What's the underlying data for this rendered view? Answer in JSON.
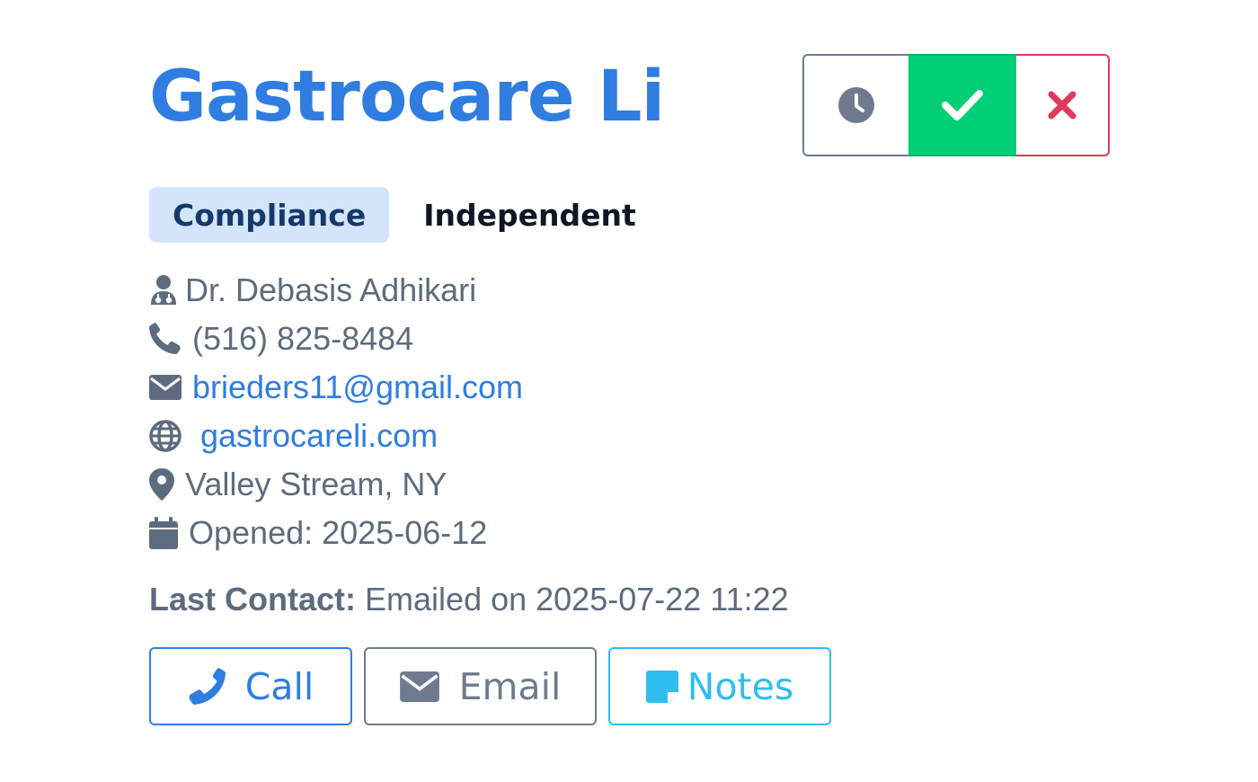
{
  "header": {
    "title": "Gastrocare Li"
  },
  "status_buttons": [
    {
      "name": "pending",
      "icon": "clock-icon",
      "color": "#6e7b8f"
    },
    {
      "name": "approve",
      "icon": "check-icon",
      "color": "#00cf75",
      "active": true
    },
    {
      "name": "reject",
      "icon": "close-icon",
      "color": "#e0395a"
    }
  ],
  "tags": {
    "primary": "Compliance",
    "secondary": "Independent"
  },
  "info": {
    "doctor": "Dr. Debasis Adhikari",
    "phone": "(516) 825-8484",
    "email": "brieders11@gmail.com",
    "website": "gastrocareli.com",
    "location": "Valley Stream, NY",
    "opened": "Opened: 2025-06-12"
  },
  "last_contact": {
    "label": "Last Contact:",
    "value": "Emailed on 2025-07-22 11:22"
  },
  "actions": {
    "call": "Call",
    "email": "Email",
    "notes": "Notes"
  },
  "colors": {
    "brand": "#2f7de1",
    "muted": "#5d6b7e",
    "success": "#00cf75",
    "danger": "#e0395a",
    "info": "#2fbdf0"
  }
}
